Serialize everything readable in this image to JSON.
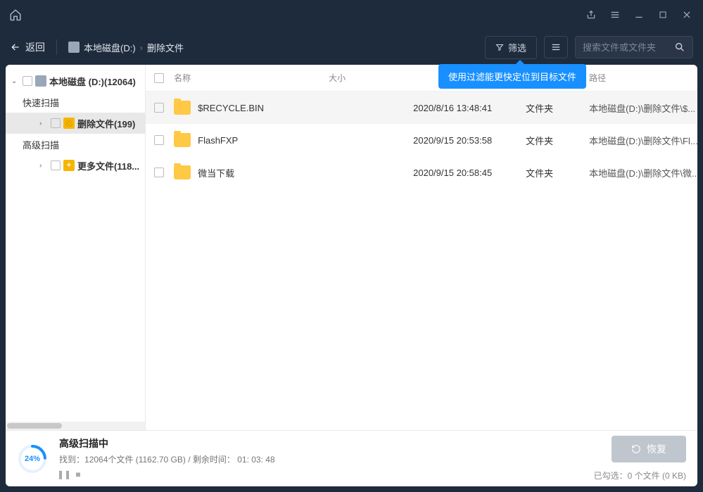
{
  "titlebar": {
    "home_icon": "home-icon",
    "share_icon": "share-icon",
    "menu_icon": "menu-icon",
    "min_icon": "minimize-icon",
    "max_icon": "maximize-icon",
    "close_icon": "close-icon"
  },
  "toolbar": {
    "back_label": "返回",
    "breadcrumb": {
      "disk_label": "本地磁盘(D:)",
      "current": "删除文件"
    },
    "filter_label": "筛选",
    "tooltip": "使用过滤能更快定位到目标文件",
    "search_placeholder": "搜索文件或文件夹"
  },
  "sidebar": {
    "root": {
      "label": "本地磁盘 (D:)(12064)"
    },
    "quick_scan": {
      "label": "快速扫描"
    },
    "deleted": {
      "label": "删除文件(199)"
    },
    "deep_scan": {
      "label": "高级扫描"
    },
    "more": {
      "label": "更多文件(118..."
    }
  },
  "columns": {
    "name": "名称",
    "size": "大小",
    "date": "",
    "type": "",
    "path": "路径"
  },
  "files": [
    {
      "name": "$RECYCLE.BIN",
      "size": "",
      "date": "2020/8/16 13:48:41",
      "type": "文件夹",
      "path": "本地磁盘(D:)\\删除文件\\$..."
    },
    {
      "name": "FlashFXP",
      "size": "",
      "date": "2020/9/15 20:53:58",
      "type": "文件夹",
      "path": "本地磁盘(D:)\\删除文件\\Fl..."
    },
    {
      "name": "微当下载",
      "size": "",
      "date": "2020/9/15 20:58:45",
      "type": "文件夹",
      "path": "本地磁盘(D:)\\删除文件\\微..."
    }
  ],
  "status": {
    "percent": "24%",
    "percent_num": 24,
    "title": "高级扫描中",
    "detail_prefix": "找到：",
    "detail_files": "12064个文件 (1162.70 GB)",
    "detail_sep": " / ",
    "detail_remain_label": "剩余时间：",
    "detail_remain_value": " 01: 03: 48",
    "recover_label": "恢复",
    "selected_label": "已勾选：0 个文件 (0 KB)"
  }
}
